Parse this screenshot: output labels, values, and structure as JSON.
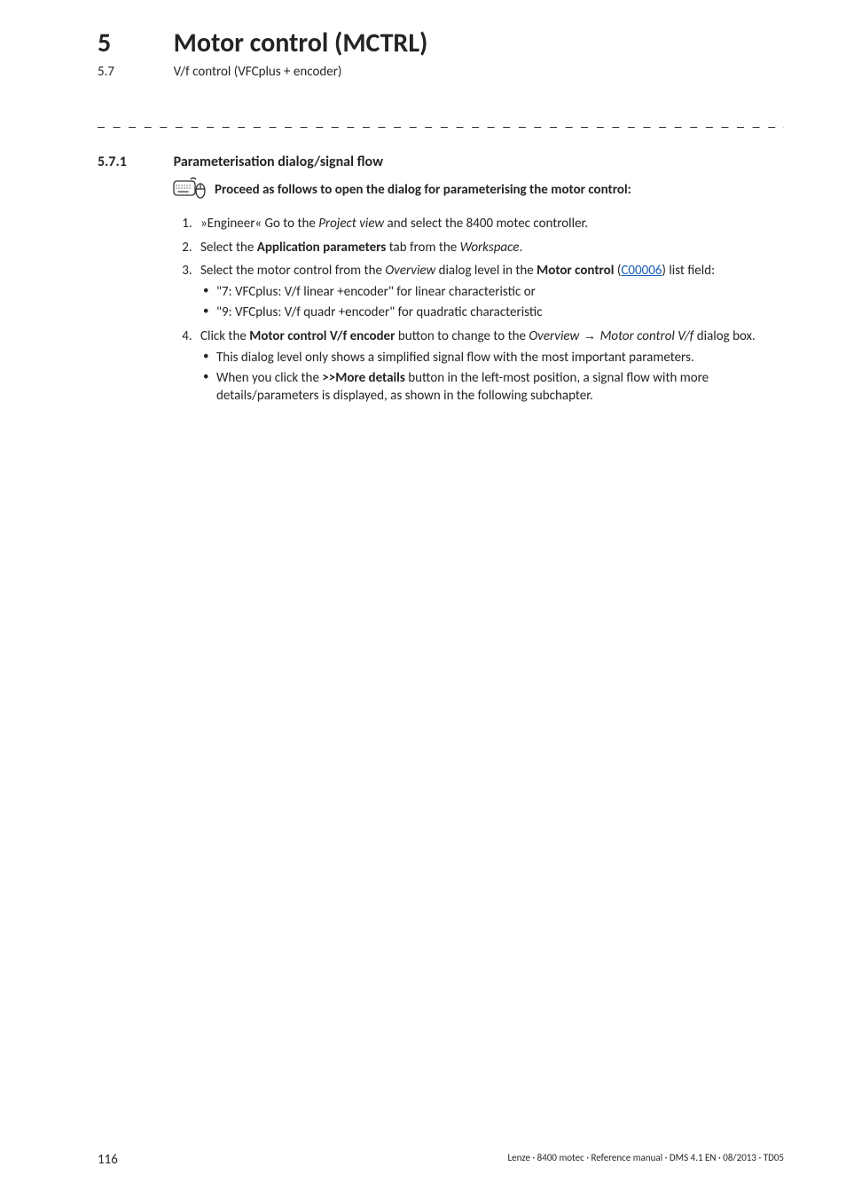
{
  "chapter": {
    "num": "5",
    "title": "Motor control (MCTRL)"
  },
  "section": {
    "num": "5.7",
    "title": "V/f control (VFCplus + encoder)"
  },
  "subsection": {
    "num": "5.7.1",
    "title": "Parameterisation dialog/signal flow"
  },
  "lead": "Proceed as follows to open the dialog for parameterising the motor control:",
  "steps": [
    {
      "pre": "»Engineer« Go to the ",
      "ital": "Project view",
      "post": " and select the 8400 motec controller."
    },
    {
      "pre": "Select the ",
      "bold": "Application parameters",
      "mid": " tab from the ",
      "ital": "Workspace",
      "post": "."
    },
    {
      "pre": "Select the motor control from the ",
      "ital": "Overview",
      "mid": " dialog level in the ",
      "bold": "Motor control",
      "post1": " (",
      "link": "C00006",
      "post2": ") list field:",
      "sub": [
        "\"7: VFCplus: V/f linear +encoder\" for linear characteristic or",
        "\"9: VFCplus: V/f quadr +encoder\" for quadratic characteristic"
      ]
    },
    {
      "pre": "Click the ",
      "bold": "Motor control V/f encoder",
      "mid": " button to change to the ",
      "ital": "Overview",
      "arrow": " → ",
      "ital2": "Motor control V/f",
      "post": " dialog box.",
      "sub": [
        "This dialog level only shows a simplified signal flow with the most important parameters.",
        {
          "pre": "When you click the ",
          "bold": ">>More details",
          "post": " button in the left-most position, a signal flow with more details/parameters is displayed, as shown in the following subchapter."
        }
      ]
    }
  ],
  "icon": {
    "name": "keyboard-mouse-icon"
  },
  "footer": {
    "page": "116",
    "right": "Lenze · 8400 motec · Reference manual · DMS 4.1 EN · 08/2013 · TD05"
  }
}
